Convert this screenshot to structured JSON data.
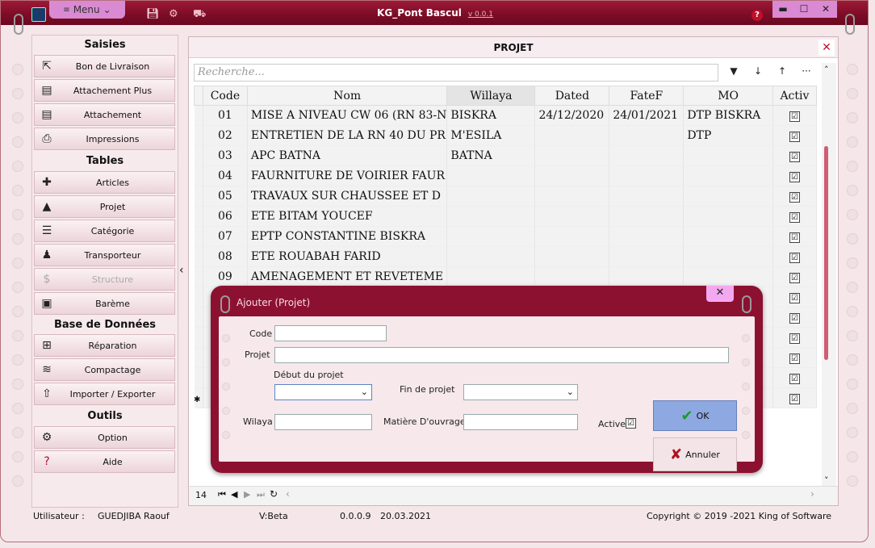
{
  "window": {
    "title": "KG_Pont Bascul",
    "version": "v 0.0.1",
    "menu_label": "Menu",
    "min": "▬",
    "max": "☐",
    "close": "✕"
  },
  "sidebar": {
    "sections": [
      {
        "title": "Saisies"
      },
      {
        "title": "Tables"
      },
      {
        "title": "Base de Données"
      },
      {
        "title": "Outils"
      }
    ],
    "items": [
      {
        "label": "Bon de Livraison",
        "icon": "share-icon",
        "glyph": "⇱"
      },
      {
        "label": "Attachement Plus",
        "icon": "card-icon",
        "glyph": "▤"
      },
      {
        "label": "Attachement",
        "icon": "card-icon",
        "glyph": "▤"
      },
      {
        "label": "Impressions",
        "icon": "printer-icon",
        "glyph": "⎙"
      },
      {
        "label": "Articles",
        "icon": "puzzle-icon",
        "glyph": "✚"
      },
      {
        "label": "Projet",
        "icon": "road-icon",
        "glyph": "▲"
      },
      {
        "label": "Catégorie",
        "icon": "list-icon",
        "glyph": "☰"
      },
      {
        "label": "Transporteur",
        "icon": "users-icon",
        "glyph": "♟"
      },
      {
        "label": "Structure",
        "icon": "dollar-icon",
        "glyph": "$"
      },
      {
        "label": "Barème",
        "icon": "money-icon",
        "glyph": "▣"
      },
      {
        "label": "Réparation",
        "icon": "toolbox-icon",
        "glyph": "⊞"
      },
      {
        "label": "Compactage",
        "icon": "stack-icon",
        "glyph": "≋"
      },
      {
        "label": "Importer  / Exporter",
        "icon": "upload-icon",
        "glyph": "⇧"
      },
      {
        "label": "Option",
        "icon": "gears-icon",
        "glyph": "⚙"
      },
      {
        "label": "Aide",
        "icon": "help-icon",
        "glyph": "?"
      }
    ]
  },
  "panel": {
    "title": "PROJET",
    "search_placeholder": "Recherche...",
    "close": "✕"
  },
  "toolbar": {
    "filter": "▼",
    "down": "↓",
    "up": "↑",
    "more": "···"
  },
  "grid": {
    "columns": [
      "Code",
      "Nom",
      "Willaya",
      "Dated",
      "FateF",
      "MO",
      "Activ"
    ],
    "rows": [
      {
        "code": "01",
        "nom": "MISE A NIVEAU CW 06 (RN 83-N",
        "willaya": "BISKRA",
        "dated": "24/12/2020",
        "fatef": "24/01/2021",
        "mo": "DTP BISKRA",
        "activ": "☑"
      },
      {
        "code": "02",
        "nom": "ENTRETIEN DE LA RN 40 DU PR",
        "willaya": "M'ESILA",
        "dated": "",
        "fatef": "",
        "mo": "DTP",
        "activ": "☑"
      },
      {
        "code": "03",
        "nom": "APC BATNA",
        "willaya": "BATNA",
        "dated": "",
        "fatef": "",
        "mo": "",
        "activ": "☑"
      },
      {
        "code": "04",
        "nom": "FAURNITURE DE VOIRIER FAUR",
        "willaya": "",
        "dated": "",
        "fatef": "",
        "mo": "",
        "activ": "☑"
      },
      {
        "code": "05",
        "nom": "TRAVAUX SUR CHAUSSEE ET D",
        "willaya": "",
        "dated": "",
        "fatef": "",
        "mo": "",
        "activ": "☑"
      },
      {
        "code": "06",
        "nom": "ETE BITAM YOUCEF",
        "willaya": "",
        "dated": "",
        "fatef": "",
        "mo": "",
        "activ": "☑"
      },
      {
        "code": "07",
        "nom": "EPTP CONSTANTINE BISKRA",
        "willaya": "",
        "dated": "",
        "fatef": "",
        "mo": "",
        "activ": "☑"
      },
      {
        "code": "08",
        "nom": "ETE ROUABAH FARID",
        "willaya": "",
        "dated": "",
        "fatef": "",
        "mo": "",
        "activ": "☑"
      },
      {
        "code": "09",
        "nom": "AMENAGEMENT ET REVETEME",
        "willaya": "",
        "dated": "",
        "fatef": "",
        "mo": "",
        "activ": "☑"
      }
    ],
    "new_row_marker": "✱",
    "record_count": "14"
  },
  "status": {
    "user_label": "Utilisateur :",
    "user": "GUEDJIBA Raouf",
    "vbeta": "V:Beta",
    "build": "0.0.0.9",
    "date": "20.03.2021",
    "copyright": "Copyright © 2019 -2021 King of Software"
  },
  "dialog": {
    "title": "Ajouter (Projet)",
    "close": "✕",
    "code_label": "Code",
    "code_value": "",
    "projet_label": "Projet",
    "projet_value": "",
    "debut_label": "Début du projet",
    "fin_label": "Fin de projet",
    "wilaya_label": "Wilaya",
    "wilaya_value": "",
    "matiere_label": "Matière D'ouvrage",
    "matiere_value": "",
    "active_label": "Active",
    "active_check": "☑",
    "ok_label": "OK",
    "annuler_label": "Annuler"
  }
}
